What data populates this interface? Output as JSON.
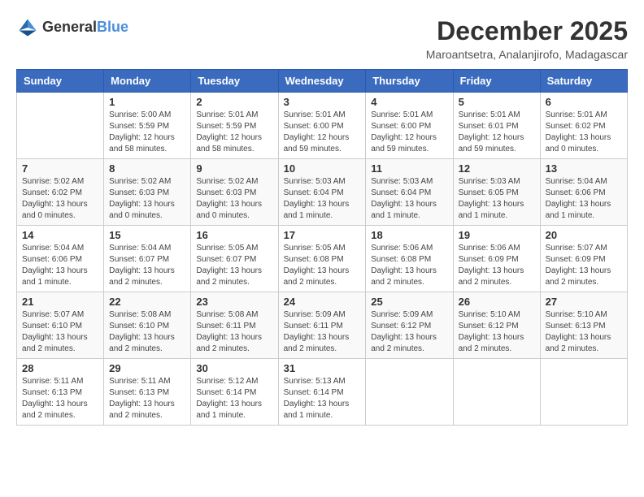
{
  "logo": {
    "general": "General",
    "blue": "Blue"
  },
  "title": {
    "month_year": "December 2025",
    "location": "Maroantsetra, Analanjirofo, Madagascar"
  },
  "calendar": {
    "headers": [
      "Sunday",
      "Monday",
      "Tuesday",
      "Wednesday",
      "Thursday",
      "Friday",
      "Saturday"
    ],
    "weeks": [
      [
        {
          "day": "",
          "info": ""
        },
        {
          "day": "1",
          "info": "Sunrise: 5:00 AM\nSunset: 5:59 PM\nDaylight: 12 hours\nand 58 minutes."
        },
        {
          "day": "2",
          "info": "Sunrise: 5:01 AM\nSunset: 5:59 PM\nDaylight: 12 hours\nand 58 minutes."
        },
        {
          "day": "3",
          "info": "Sunrise: 5:01 AM\nSunset: 6:00 PM\nDaylight: 12 hours\nand 59 minutes."
        },
        {
          "day": "4",
          "info": "Sunrise: 5:01 AM\nSunset: 6:00 PM\nDaylight: 12 hours\nand 59 minutes."
        },
        {
          "day": "5",
          "info": "Sunrise: 5:01 AM\nSunset: 6:01 PM\nDaylight: 12 hours\nand 59 minutes."
        },
        {
          "day": "6",
          "info": "Sunrise: 5:01 AM\nSunset: 6:02 PM\nDaylight: 13 hours\nand 0 minutes."
        }
      ],
      [
        {
          "day": "7",
          "info": "Sunrise: 5:02 AM\nSunset: 6:02 PM\nDaylight: 13 hours\nand 0 minutes."
        },
        {
          "day": "8",
          "info": "Sunrise: 5:02 AM\nSunset: 6:03 PM\nDaylight: 13 hours\nand 0 minutes."
        },
        {
          "day": "9",
          "info": "Sunrise: 5:02 AM\nSunset: 6:03 PM\nDaylight: 13 hours\nand 0 minutes."
        },
        {
          "day": "10",
          "info": "Sunrise: 5:03 AM\nSunset: 6:04 PM\nDaylight: 13 hours\nand 1 minute."
        },
        {
          "day": "11",
          "info": "Sunrise: 5:03 AM\nSunset: 6:04 PM\nDaylight: 13 hours\nand 1 minute."
        },
        {
          "day": "12",
          "info": "Sunrise: 5:03 AM\nSunset: 6:05 PM\nDaylight: 13 hours\nand 1 minute."
        },
        {
          "day": "13",
          "info": "Sunrise: 5:04 AM\nSunset: 6:06 PM\nDaylight: 13 hours\nand 1 minute."
        }
      ],
      [
        {
          "day": "14",
          "info": "Sunrise: 5:04 AM\nSunset: 6:06 PM\nDaylight: 13 hours\nand 1 minute."
        },
        {
          "day": "15",
          "info": "Sunrise: 5:04 AM\nSunset: 6:07 PM\nDaylight: 13 hours\nand 2 minutes."
        },
        {
          "day": "16",
          "info": "Sunrise: 5:05 AM\nSunset: 6:07 PM\nDaylight: 13 hours\nand 2 minutes."
        },
        {
          "day": "17",
          "info": "Sunrise: 5:05 AM\nSunset: 6:08 PM\nDaylight: 13 hours\nand 2 minutes."
        },
        {
          "day": "18",
          "info": "Sunrise: 5:06 AM\nSunset: 6:08 PM\nDaylight: 13 hours\nand 2 minutes."
        },
        {
          "day": "19",
          "info": "Sunrise: 5:06 AM\nSunset: 6:09 PM\nDaylight: 13 hours\nand 2 minutes."
        },
        {
          "day": "20",
          "info": "Sunrise: 5:07 AM\nSunset: 6:09 PM\nDaylight: 13 hours\nand 2 minutes."
        }
      ],
      [
        {
          "day": "21",
          "info": "Sunrise: 5:07 AM\nSunset: 6:10 PM\nDaylight: 13 hours\nand 2 minutes."
        },
        {
          "day": "22",
          "info": "Sunrise: 5:08 AM\nSunset: 6:10 PM\nDaylight: 13 hours\nand 2 minutes."
        },
        {
          "day": "23",
          "info": "Sunrise: 5:08 AM\nSunset: 6:11 PM\nDaylight: 13 hours\nand 2 minutes."
        },
        {
          "day": "24",
          "info": "Sunrise: 5:09 AM\nSunset: 6:11 PM\nDaylight: 13 hours\nand 2 minutes."
        },
        {
          "day": "25",
          "info": "Sunrise: 5:09 AM\nSunset: 6:12 PM\nDaylight: 13 hours\nand 2 minutes."
        },
        {
          "day": "26",
          "info": "Sunrise: 5:10 AM\nSunset: 6:12 PM\nDaylight: 13 hours\nand 2 minutes."
        },
        {
          "day": "27",
          "info": "Sunrise: 5:10 AM\nSunset: 6:13 PM\nDaylight: 13 hours\nand 2 minutes."
        }
      ],
      [
        {
          "day": "28",
          "info": "Sunrise: 5:11 AM\nSunset: 6:13 PM\nDaylight: 13 hours\nand 2 minutes."
        },
        {
          "day": "29",
          "info": "Sunrise: 5:11 AM\nSunset: 6:13 PM\nDaylight: 13 hours\nand 2 minutes."
        },
        {
          "day": "30",
          "info": "Sunrise: 5:12 AM\nSunset: 6:14 PM\nDaylight: 13 hours\nand 1 minute."
        },
        {
          "day": "31",
          "info": "Sunrise: 5:13 AM\nSunset: 6:14 PM\nDaylight: 13 hours\nand 1 minute."
        },
        {
          "day": "",
          "info": ""
        },
        {
          "day": "",
          "info": ""
        },
        {
          "day": "",
          "info": ""
        }
      ]
    ]
  }
}
